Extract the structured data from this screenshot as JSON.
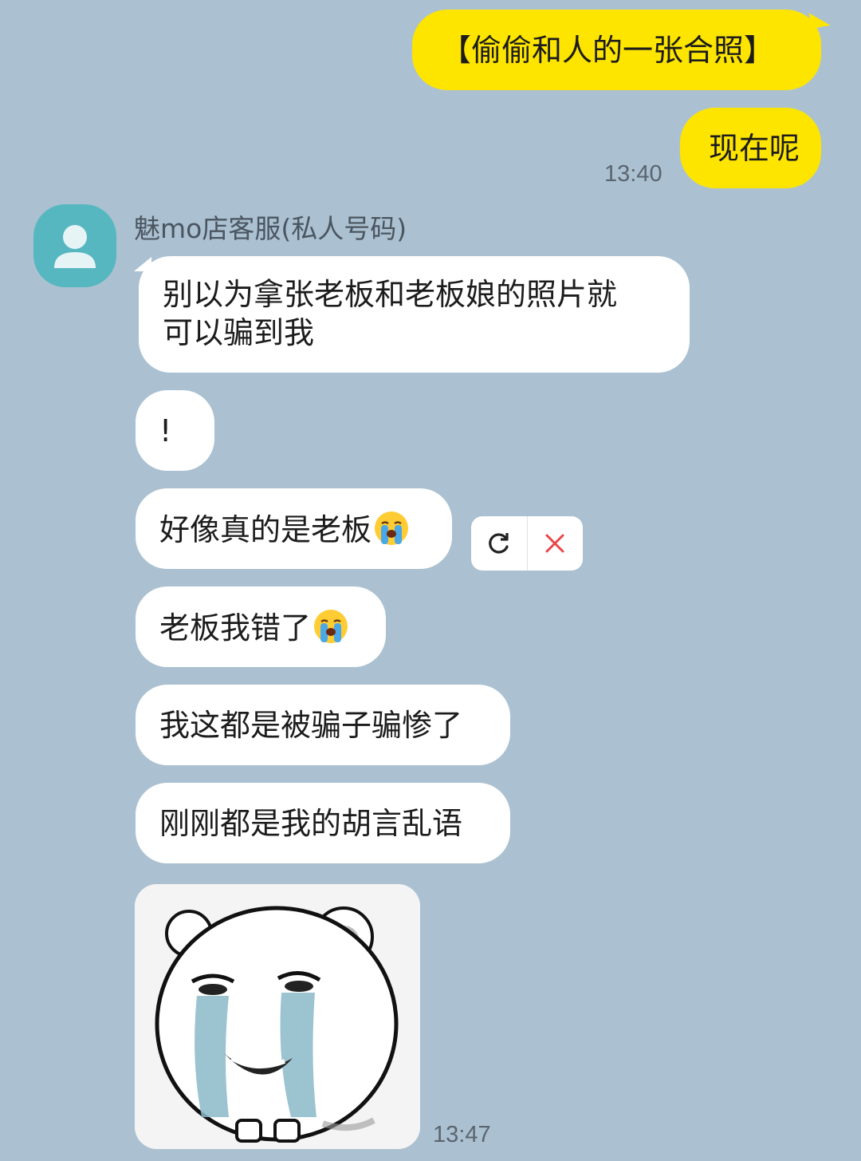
{
  "messages": {
    "outgoing": [
      {
        "text": "【偷偷和人的一张合照】"
      },
      {
        "text": "现在呢",
        "time": "13:40"
      }
    ],
    "sender_name": "魅mo店客服(私人号码)",
    "incoming": [
      {
        "line1": "别以为拿张老板和老板娘的照片就",
        "line2": "可以骗到我"
      },
      {
        "text": "!"
      },
      {
        "text": "好像真的是老板",
        "emoji": "loudly-crying-face"
      },
      {
        "text": "老板我错了",
        "emoji": "loudly-crying-face"
      },
      {
        "text": "我这都是被骗子骗惨了"
      },
      {
        "text": "刚刚都是我的胡言乱语"
      }
    ],
    "sticker": {
      "icon": "crying-bear-sticker",
      "time": "13:47"
    }
  },
  "failed_message_actions": {
    "retry_icon": "refresh-icon",
    "delete_icon": "close-icon",
    "delete_color": "#e8474a"
  },
  "colors": {
    "background": "#abc1d1",
    "mine_bubble": "#fee500",
    "theirs_bubble": "#ffffff",
    "avatar": "#57b7c0"
  }
}
